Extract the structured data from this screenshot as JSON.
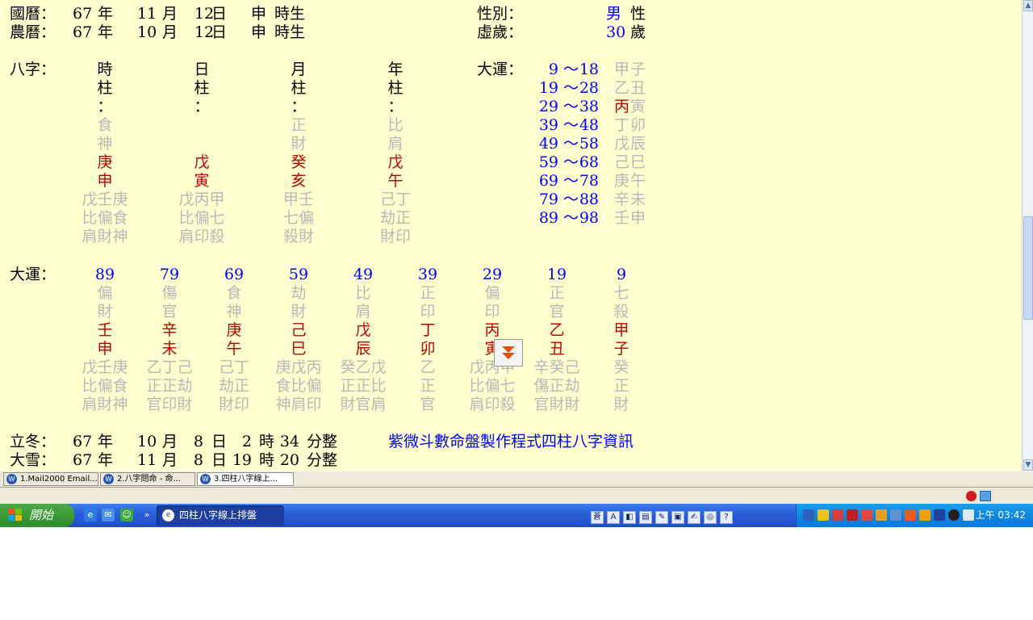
{
  "header": {
    "guoli_label": "國曆：",
    "guoli_year": "67",
    "guoli_month": "11",
    "guoli_day": "12",
    "guoli_hour": "申",
    "nongli_label": "農曆：",
    "nongli_year": "67",
    "nongli_month": "10",
    "nongli_day": "12",
    "nongli_hour": "申",
    "unit_year": "年",
    "unit_month": "月",
    "unit_day": "日",
    "unit_hour": "時生",
    "gender_label": "性別：",
    "gender_value": "男",
    "gender_unit": "性",
    "age_label": "虛歲：",
    "age_value": "30",
    "age_unit": "歲"
  },
  "bazi": {
    "label": "八字：",
    "pillars": [
      {
        "name1": "時",
        "name2": "柱",
        "colon": "：",
        "god1": "食",
        "god2": "神",
        "stem": "庚",
        "branch": "申",
        "hidden": [
          "戊壬庚",
          "比偏食",
          "肩財神"
        ]
      },
      {
        "name1": "日",
        "name2": "柱",
        "colon": "：",
        "god1": "",
        "god2": "",
        "stem": "戊",
        "branch": "寅",
        "hidden": [
          "戊丙甲",
          "比偏七",
          "肩印殺"
        ]
      },
      {
        "name1": "月",
        "name2": "柱",
        "colon": "：",
        "god1": "正",
        "god2": "財",
        "stem": "癸",
        "branch": "亥",
        "hidden": [
          "甲壬",
          "七偏",
          "殺財"
        ]
      },
      {
        "name1": "年",
        "name2": "柱",
        "colon": "：",
        "god1": "比",
        "god2": "肩",
        "stem": "戊",
        "branch": "午",
        "hidden": [
          "己丁",
          "劫正",
          "財印"
        ]
      }
    ]
  },
  "dayun_list": {
    "label": "大運：",
    "tilde": "～",
    "rows": [
      {
        "from": "9",
        "to": "18",
        "stem": "甲",
        "branch": "子",
        "stem_color": "gray"
      },
      {
        "from": "19",
        "to": "28",
        "stem": "乙",
        "branch": "丑",
        "stem_color": "gray"
      },
      {
        "from": "29",
        "to": "38",
        "stem": "丙",
        "branch": "寅",
        "stem_color": "red"
      },
      {
        "from": "39",
        "to": "48",
        "stem": "丁",
        "branch": "卯",
        "stem_color": "gray"
      },
      {
        "from": "49",
        "to": "58",
        "stem": "戊",
        "branch": "辰",
        "stem_color": "gray"
      },
      {
        "from": "59",
        "to": "68",
        "stem": "己",
        "branch": "巳",
        "stem_color": "gray"
      },
      {
        "from": "69",
        "to": "78",
        "stem": "庚",
        "branch": "午",
        "stem_color": "gray"
      },
      {
        "from": "79",
        "to": "88",
        "stem": "辛",
        "branch": "未",
        "stem_color": "gray"
      },
      {
        "from": "89",
        "to": "98",
        "stem": "壬",
        "branch": "申",
        "stem_color": "gray"
      }
    ]
  },
  "dayun_detail": {
    "label": "大運：",
    "columns": [
      {
        "age": "89",
        "god1": "偏",
        "god2": "財",
        "stem": "壬",
        "branch": "申",
        "hidden": [
          "戊壬庚",
          "比偏食",
          "肩財神"
        ]
      },
      {
        "age": "79",
        "god1": "傷",
        "god2": "官",
        "stem": "辛",
        "branch": "未",
        "hidden": [
          "乙丁己",
          "正正劫",
          "官印財"
        ]
      },
      {
        "age": "69",
        "god1": "食",
        "god2": "神",
        "stem": "庚",
        "branch": "午",
        "hidden": [
          "己丁",
          "劫正",
          "財印"
        ]
      },
      {
        "age": "59",
        "god1": "劫",
        "god2": "財",
        "stem": "己",
        "branch": "巳",
        "hidden": [
          "庚戊丙",
          "食比偏",
          "神肩印"
        ]
      },
      {
        "age": "49",
        "god1": "比",
        "god2": "肩",
        "stem": "戊",
        "branch": "辰",
        "hidden": [
          "癸乙戊",
          "正正比",
          "財官肩"
        ]
      },
      {
        "age": "39",
        "god1": "正",
        "god2": "印",
        "stem": "丁",
        "branch": "卯",
        "hidden": [
          "乙",
          "正",
          "官"
        ]
      },
      {
        "age": "29",
        "god1": "偏",
        "god2": "印",
        "stem": "丙",
        "branch": "寅",
        "hidden": [
          "戊丙甲",
          "比偏七",
          "肩印殺"
        ]
      },
      {
        "age": "19",
        "god1": "正",
        "god2": "官",
        "stem": "乙",
        "branch": "丑",
        "hidden": [
          "辛癸己",
          "傷正劫",
          "官財財"
        ]
      },
      {
        "age": "9",
        "god1": "七",
        "god2": "殺",
        "stem": "甲",
        "branch": "子",
        "hidden": [
          "癸",
          "正",
          "財"
        ]
      }
    ]
  },
  "jieqi": [
    {
      "label": "立冬：",
      "year": "67",
      "month": "10",
      "day": "8",
      "hour": "2",
      "minute": "34"
    },
    {
      "label": "大雪：",
      "year": "67",
      "month": "11",
      "day": "8",
      "hour": "19",
      "minute": "20"
    }
  ],
  "jieqi_units": {
    "year": "年",
    "month": "月",
    "day": "日",
    "hour": "時",
    "minute": "分整"
  },
  "link_text": "紫微斗數命盤製作程式四柱八字資訊",
  "tabs": [
    "1.Mail2000 Email...",
    "2.八字問命 - 命...",
    "3.四柱八字線上..."
  ],
  "taskbar": {
    "start_label": "開始",
    "task_label": "四柱八字線上排盤",
    "clock": "上午 03:42",
    "ime_char": "蒼"
  },
  "colors": {
    "page_bg": "#ffffd0",
    "stem_branch": "#c00000",
    "number": "#0000ff",
    "muted": "#b8b8b8"
  }
}
